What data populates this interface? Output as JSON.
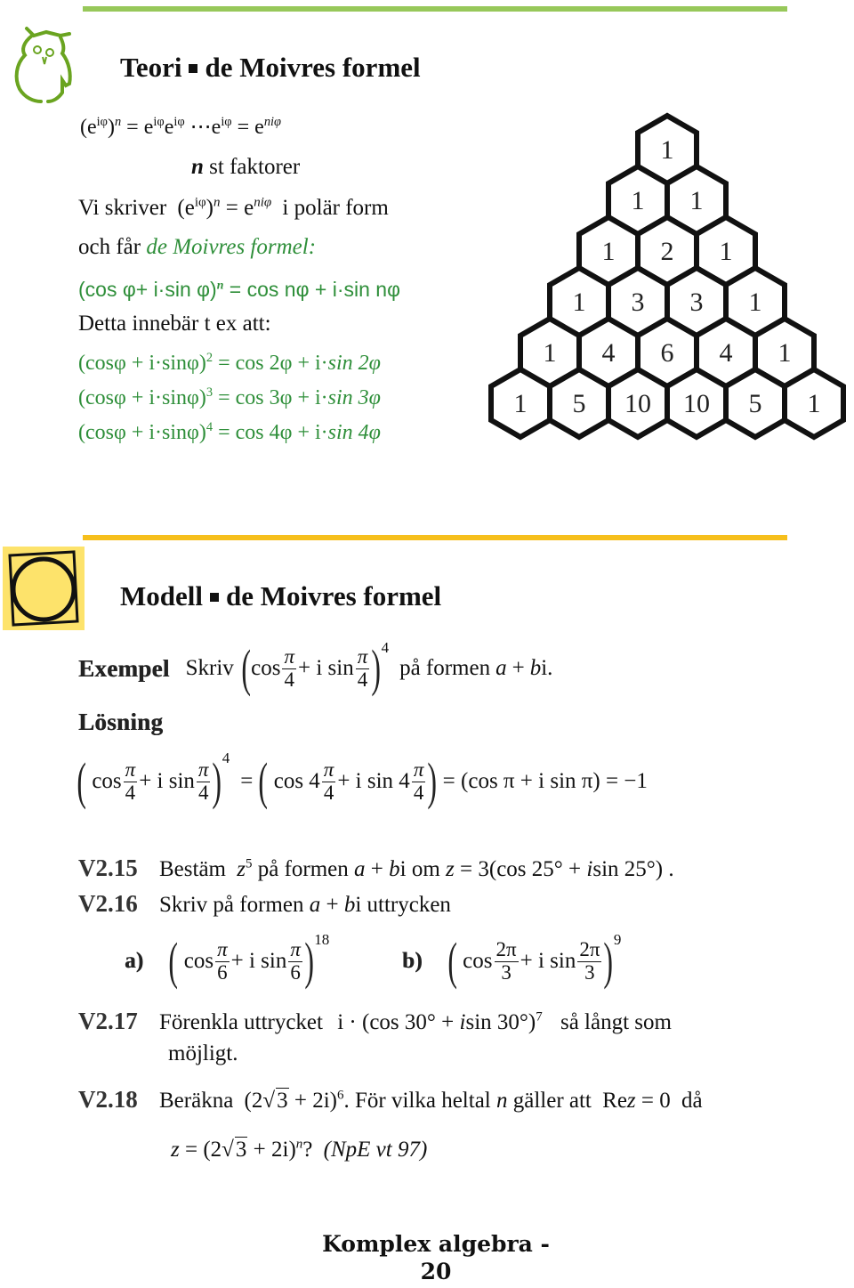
{
  "colors": {
    "teori_rule": "#97c85a",
    "modell_rule": "#f6bf1c",
    "formula_green": "#2f8f3a",
    "owl_green": "#6aa420",
    "modell_icon_bg": "#fde36b"
  },
  "icons": {
    "teori": "owl-icon",
    "modell": "circle-in-square-icon"
  },
  "teori": {
    "title_left": "Teori",
    "title_right": "de Moivres formel",
    "line1": {
      "lhs": "(e",
      "lhs_exp": "iφ",
      "lhs_close": ")",
      "n": "n",
      "eq": "=",
      "terms": "e",
      "term_exp": "iφ",
      "dots": "⋯",
      "rhs": "e",
      "rhs_exp": "niφ"
    },
    "factors_n": "n",
    "factors_text": "st faktorer",
    "vi_skriver": "Vi skriver",
    "polar_expr_open": "(e",
    "polar_expr_exp": "iφ",
    "polar_expr_close": ")",
    "polar_expr_n": "n",
    "polar_eq": "= e",
    "polar_rhs_exp": "niφ",
    "polar_form": "i polär form",
    "och_far": "och får",
    "de_moivres_label": "de Moivres formel:",
    "formula_main": {
      "lhs": "(cos φ+ i·sin φ)",
      "exp": "n",
      "rhs": "= cos nφ + i·sin nφ"
    },
    "detta_innebar": "Detta innebär t ex att:",
    "examples": [
      {
        "lhs": "(cosφ + i·sinφ)",
        "exp": "2",
        "rhs_a": "= cos 2φ + i·",
        "rhs_b": "sin 2φ"
      },
      {
        "lhs": "(cosφ + i·sinφ)",
        "exp": "3",
        "rhs_a": "= cos 3φ + i·",
        "rhs_b": "sin 3φ"
      },
      {
        "lhs": "(cosφ + i·sinφ)",
        "exp": "4",
        "rhs_a": "= cos 4φ + i·",
        "rhs_b": "sin 4φ"
      }
    ]
  },
  "pascal": {
    "rows": [
      [
        1
      ],
      [
        1,
        1
      ],
      [
        1,
        2,
        1
      ],
      [
        1,
        3,
        3,
        1
      ],
      [
        1,
        4,
        6,
        4,
        1
      ],
      [
        1,
        5,
        10,
        10,
        5,
        1
      ]
    ]
  },
  "modell": {
    "title_left": "Modell",
    "title_right": "de Moivres formel",
    "exempel_label": "Exempel",
    "skriv": "Skriv",
    "expr": {
      "cos": "cos",
      "plus_isin": "+ i sin",
      "pi": "π",
      "den": "4",
      "exp": "4"
    },
    "pa_formen": "på formen",
    "a": "a",
    "plus": "+",
    "b": "b",
    "i_dot": "i.",
    "losning_label": "Lösning",
    "solution": {
      "cos": "cos",
      "plus_isin": "+ i sin",
      "pi": "π",
      "den": "4",
      "exp": "4",
      "eq1": "=",
      "cos4": "cos 4",
      "plus_isin4": "+ i sin 4",
      "eq2": "= (cos π + i sin π) = −1"
    }
  },
  "exercises": {
    "v215": {
      "num": "V2.15",
      "text1": "Bestäm",
      "z": "z",
      "z_exp": "5",
      "text2": "på formen",
      "a": "a",
      "plus": "+",
      "b": "b",
      "text3": "i om",
      "z2": "z",
      "eq": "=",
      "expr_a": "3(cos 25° +",
      "i": "i",
      "expr_b": "sin 25°) ."
    },
    "v216": {
      "num": "V2.16",
      "text1": "Skriv på formen",
      "a": "a",
      "plus": "+",
      "b": "b",
      "text2": "i uttrycken",
      "parts": [
        {
          "label": "a)",
          "cos": "cos",
          "plus_isin": "+ i sin",
          "num": "π",
          "den": "6",
          "exp": "18"
        },
        {
          "label": "b)",
          "cos": "cos",
          "plus_isin": "+ i sin",
          "num": "2π",
          "den": "3",
          "exp": "9"
        }
      ]
    },
    "v217": {
      "num": "V2.17",
      "text1": "Förenkla uttrycket",
      "expr_a": "i · (cos 30° +",
      "i": "i",
      "expr_b": "sin 30°)",
      "exp": "7",
      "text2": "så långt som",
      "text3": "möjligt."
    },
    "v218": {
      "num": "V2.18",
      "text1": "Beräkna",
      "expr_a": "(2",
      "sqrt": "3",
      "expr_b": "+ 2i)",
      "exp": "6",
      "text2": ". För vilka heltal",
      "n": "n",
      "text3": "gäller att",
      "re": "Re",
      "z": "z",
      "re_eq": "= 0",
      "text4": "då",
      "line2_z": "z",
      "line2_eq": "=",
      "line2_exp": "n",
      "line2_q": "?",
      "source": "(NpE vt 97)"
    }
  },
  "footer": {
    "line1": "Komplex algebra -",
    "line2": "20"
  }
}
